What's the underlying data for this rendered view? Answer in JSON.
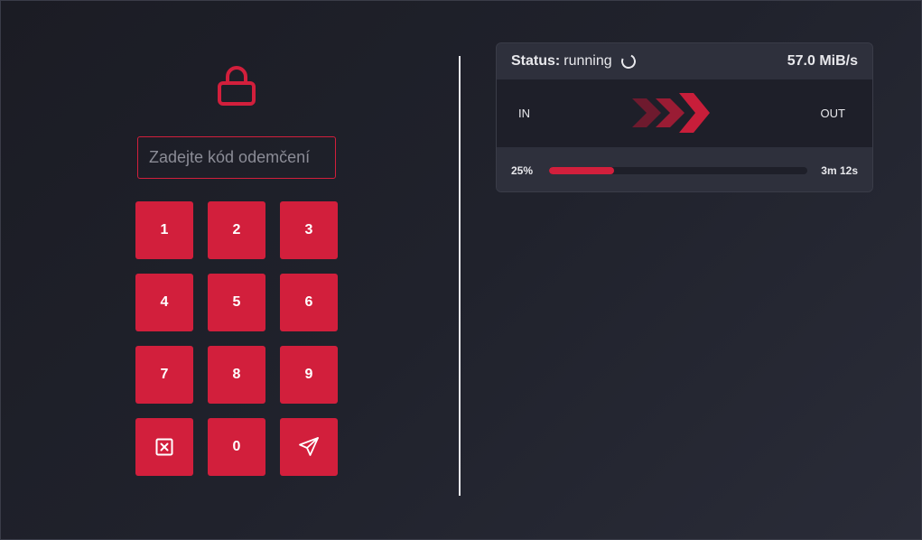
{
  "unlock": {
    "icon": "lock-icon",
    "placeholder": "Zadejte kód odemčení",
    "value": "",
    "keys": [
      {
        "label": "1",
        "name": "key-1"
      },
      {
        "label": "2",
        "name": "key-2"
      },
      {
        "label": "3",
        "name": "key-3"
      },
      {
        "label": "4",
        "name": "key-4"
      },
      {
        "label": "5",
        "name": "key-5"
      },
      {
        "label": "6",
        "name": "key-6"
      },
      {
        "label": "7",
        "name": "key-7"
      },
      {
        "label": "8",
        "name": "key-8"
      },
      {
        "label": "9",
        "name": "key-9"
      },
      {
        "label": "",
        "name": "clear-key",
        "icon": "clear-icon"
      },
      {
        "label": "0",
        "name": "key-0"
      },
      {
        "label": "",
        "name": "submit-key",
        "icon": "send-icon"
      }
    ]
  },
  "transfer": {
    "status_label": "Status:",
    "status_value": "running",
    "status_icon": "spinner-icon",
    "speed": "57.0 MiB/s",
    "flow_in": "IN",
    "flow_out": "OUT",
    "flow_icon": "chevrons-right-icon",
    "progress_percent": 25,
    "progress_label": "25%",
    "eta": "3m 12s"
  },
  "colors": {
    "accent": "#d21f3c",
    "background": "#1d1e27",
    "panel": "#2e303c",
    "panel_dark": "#1e1f29"
  }
}
